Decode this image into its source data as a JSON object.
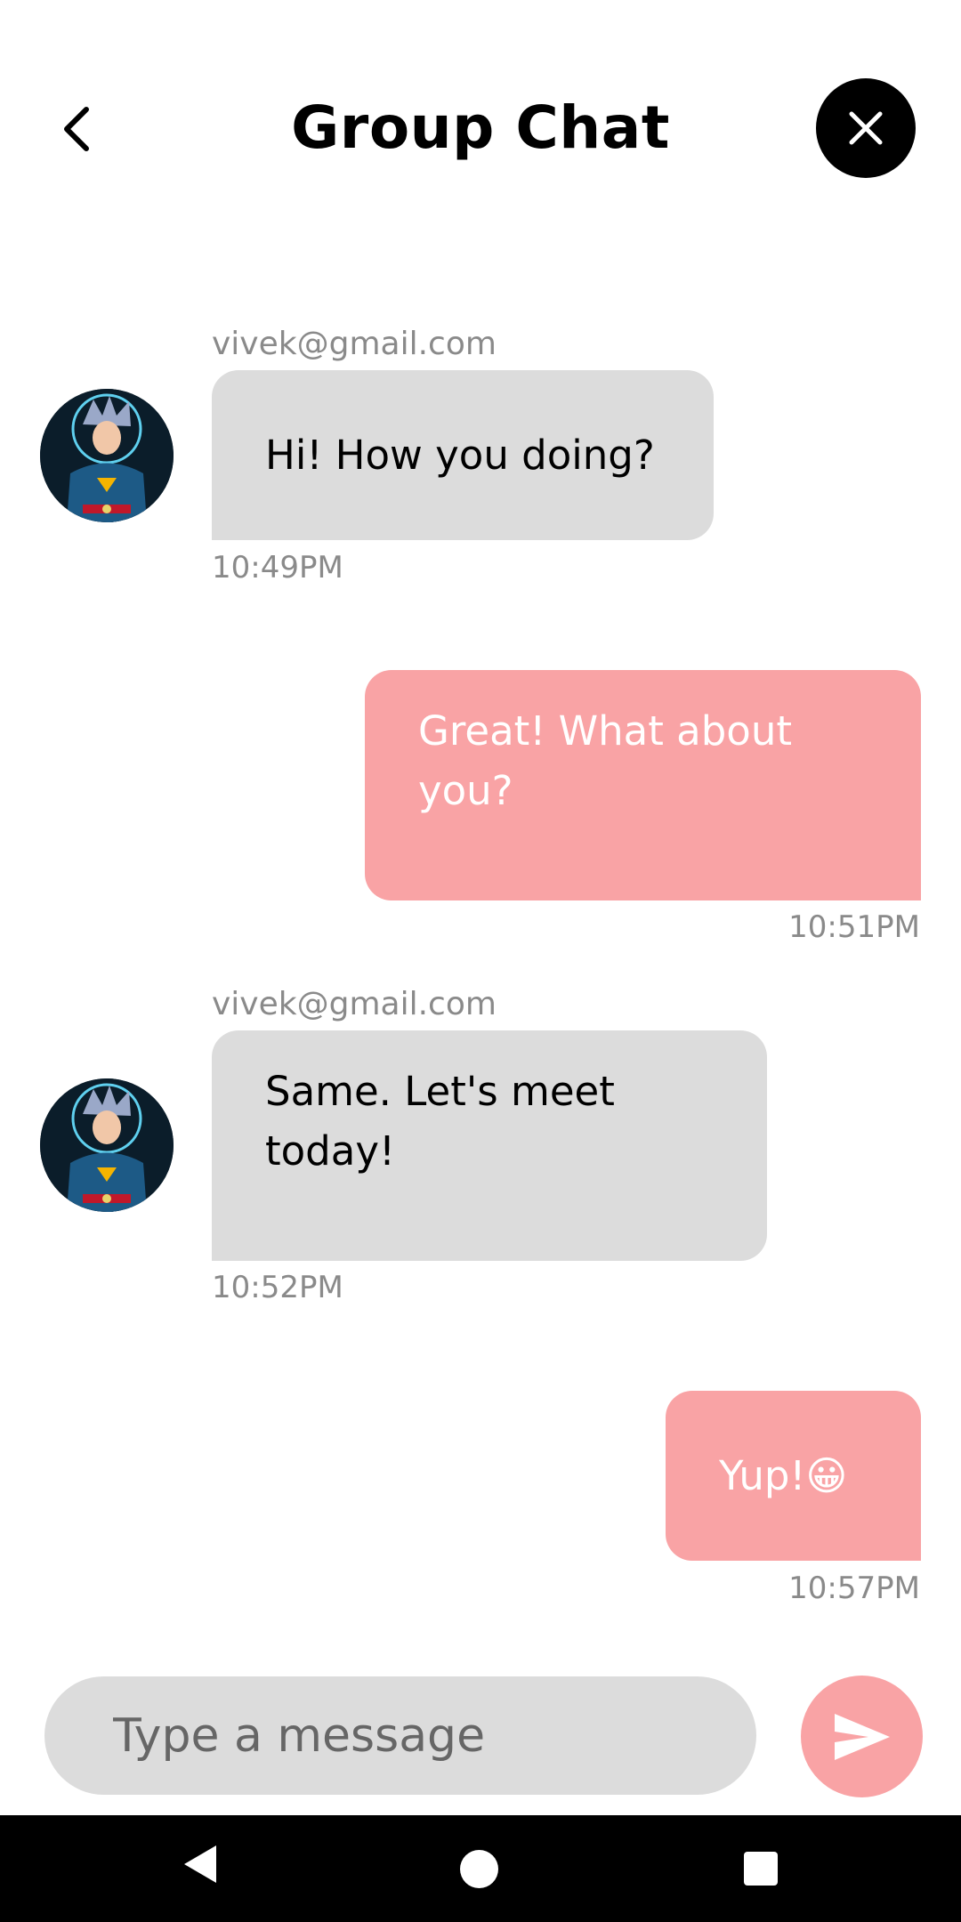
{
  "header": {
    "title": "Group Chat",
    "back_icon": "chevron-left-icon",
    "close_icon": "close-icon"
  },
  "messages": [
    {
      "direction": "incoming",
      "sender": "vivek@gmail.com",
      "text": "Hi! How you doing?",
      "time": "10:49PM"
    },
    {
      "direction": "outgoing",
      "text": "Great! What about you?",
      "time": "10:51PM"
    },
    {
      "direction": "incoming",
      "sender": "vivek@gmail.com",
      "text": "Same. Let's meet today!",
      "time": "10:52PM"
    },
    {
      "direction": "outgoing",
      "text": "Yup!😀",
      "time": "10:57PM"
    }
  ],
  "composer": {
    "placeholder": "Type a message",
    "send_icon": "send-icon"
  },
  "navbar": {
    "icons": [
      "nav-back-icon",
      "nav-home-icon",
      "nav-recents-icon"
    ]
  },
  "colors": {
    "incoming_bubble": "#dcdcdc",
    "outgoing_bubble": "#f9a3a5",
    "meta_text": "#8a8a8a",
    "close_button": "#000000"
  }
}
